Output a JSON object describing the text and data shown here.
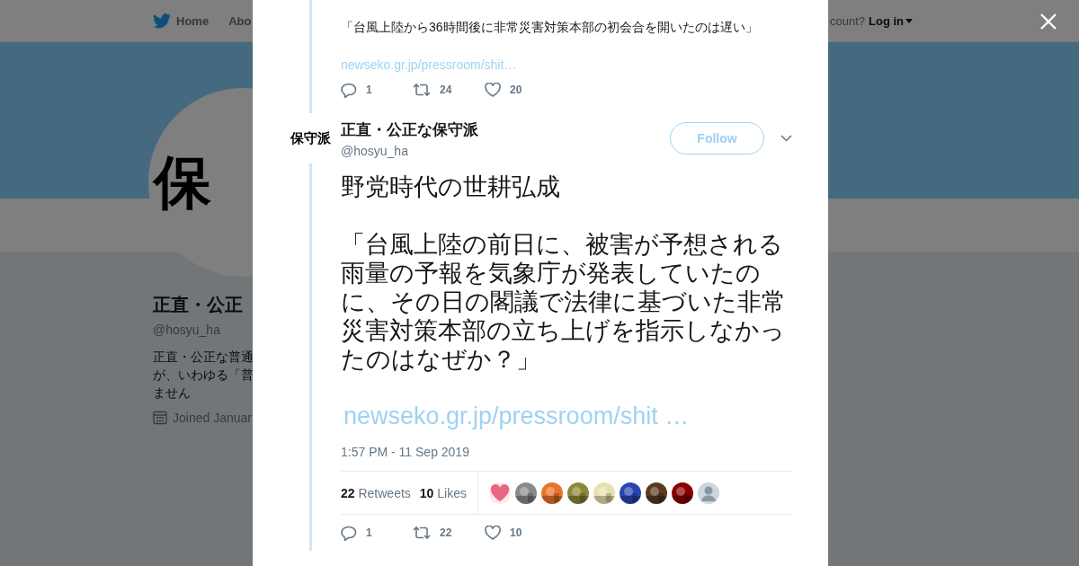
{
  "nav": {
    "items": [
      {
        "label": "Home",
        "selected": false
      },
      {
        "label": "Abo",
        "selected": false
      }
    ],
    "account_prompt": "count?",
    "login": "Log in"
  },
  "profile": {
    "avatar_text": "保",
    "name": "正直・公正",
    "handle": "@hosyu_ha",
    "bio_lines": [
      "正直・公正な普通",
      "が、いわゆる「普",
      "ません"
    ],
    "joined": "Joined Januar"
  },
  "modal": {
    "previous_tweet": {
      "text": "「台風上陸から36時間後に非常災害対策本部の初会合を開いたのは遅い」",
      "link": "newseko.gr.jp/pressroom/shit…",
      "actions": [
        {
          "kind": "reply",
          "count": "1"
        },
        {
          "kind": "retweet",
          "count": "24"
        },
        {
          "kind": "like",
          "count": "20"
        }
      ]
    },
    "tweet": {
      "avatar_text": "保守派",
      "name": "正直・公正な保守派",
      "handle": "@hosyu_ha",
      "follow": "Follow",
      "paragraphs": [
        "野党時代の世耕弘成",
        "「台風上陸の前日に、被害が予想される雨量の予報を気象庁が発表していたのに、その日の閣議で法律に基づいた非常災害対策本部の立ち上げを指示しなかったのはなぜか？」"
      ],
      "link": "newseko.gr.jp/pressroom/shit …",
      "time": "1:57 PM - 11 Sep 2019",
      "stats": [
        {
          "count": "22",
          "label": "Retweets"
        },
        {
          "count": "10",
          "label": "Likes"
        }
      ],
      "likers": [
        {
          "kind": "heart",
          "color": "#e8667e"
        },
        {
          "kind": "picture",
          "color": "#8a8a8a"
        },
        {
          "kind": "picture",
          "color": "#e8742c"
        },
        {
          "kind": "picture",
          "color": "#8a8a3a"
        },
        {
          "kind": "picture",
          "color": "#e6e2b0"
        },
        {
          "kind": "picture",
          "color": "#2b45b0"
        },
        {
          "kind": "picture",
          "color": "#5a3a20"
        },
        {
          "kind": "picture",
          "color": "#8b0000"
        },
        {
          "kind": "default",
          "color": "#ccd6dd"
        }
      ],
      "actions": [
        {
          "kind": "reply",
          "count": "1"
        },
        {
          "kind": "retweet",
          "count": "22"
        },
        {
          "kind": "like",
          "count": "10"
        }
      ]
    }
  }
}
